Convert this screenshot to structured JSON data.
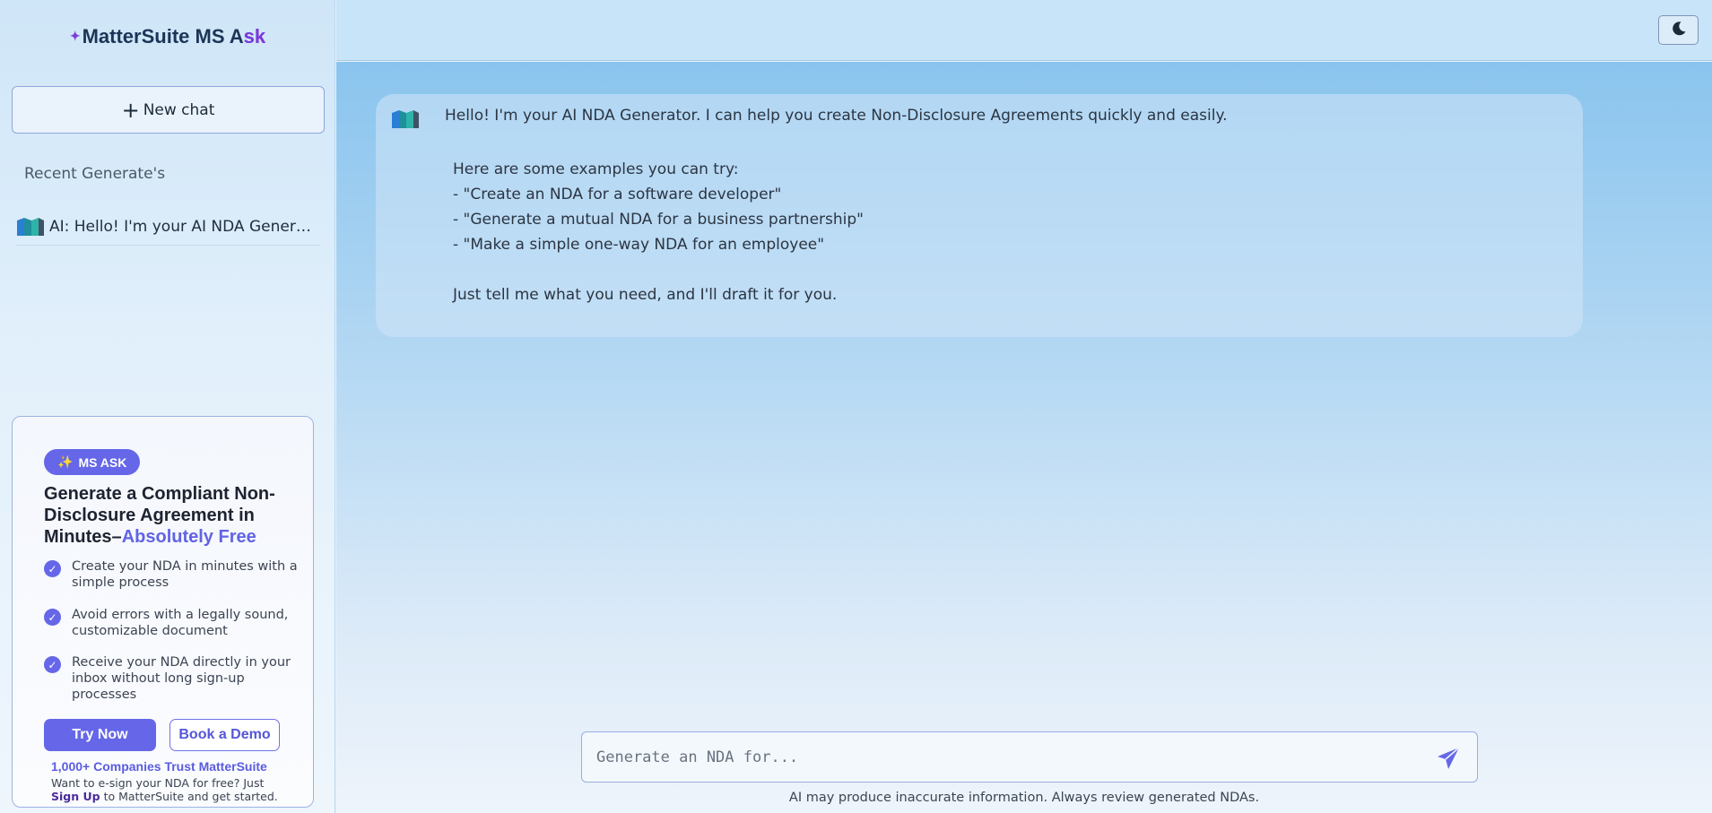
{
  "sidebar": {
    "brand_prefix": "MatterSuite MS A",
    "brand_suffix": "sk",
    "new_chat_label": "New chat",
    "recent_title": "Recent Generate's",
    "recent_items": [
      {
        "label": "AI: Hello! I'm your AI NDA Generator. I can help you create Non-Disclosure Agreements quickly and easily."
      }
    ]
  },
  "promo": {
    "badge": "MS ASK",
    "badge_icon": "sparkles",
    "title_main": "Generate a Compliant Non-Disclosure Agreement in Minutes–",
    "title_accent": "Absolutely Free",
    "features": [
      "Create your NDA in minutes with a simple process",
      "Avoid errors with a legally sound, customizable document",
      "Receive your NDA directly in your inbox without long sign-up processes"
    ],
    "try_now": "Try Now",
    "book_demo": "Book a Demo",
    "trust": "1,000+ Companies Trust MatterSuite",
    "esign_prefix": "Want to e-sign your NDA for free? Just",
    "signup": "Sign Up",
    "esign_suffix": "to MatterSuite and get started."
  },
  "chat": {
    "greeting": "Hello! I'm your AI NDA Generator. I can help you create Non-Disclosure Agreements quickly and easily.",
    "examples_intro": "Here are some examples you can try:",
    "examples": [
      "- \"Create an NDA for a software developer\"",
      "- \"Generate a mutual NDA for a business partnership\"",
      "- \"Make a simple one-way NDA for an employee\""
    ],
    "closing": "Just tell me what you need, and I'll draft it for you."
  },
  "composer": {
    "placeholder": "Generate an NDA for...",
    "value": ""
  },
  "disclaimer": "AI may produce inaccurate information. Always review generated NDAs.",
  "colors": {
    "accent": "#6567e8",
    "brand_dark": "#1c3557"
  }
}
